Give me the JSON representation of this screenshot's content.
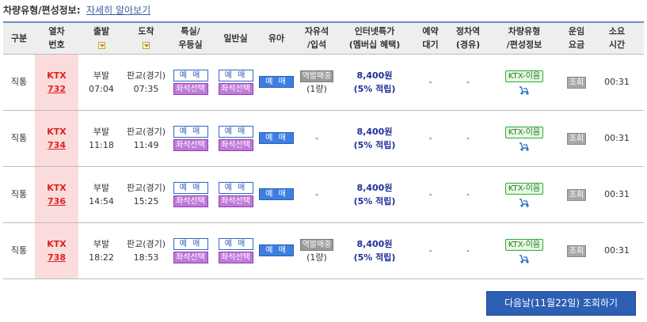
{
  "header": {
    "label": "차량유형/편성정보:",
    "link": "자세히 알아보기"
  },
  "columns": {
    "type": "구분",
    "train_no": [
      "열차",
      "번호"
    ],
    "depart": "출발",
    "arrive": "도착",
    "special": [
      "특실/",
      "우등실"
    ],
    "general": "일반실",
    "infant": "유아",
    "standing": [
      "자유석",
      "/입석"
    ],
    "internet": [
      "인터넷특가",
      "(멤버십 혜택)"
    ],
    "reserve_wait": [
      "예약",
      "대기"
    ],
    "stop_station": [
      "정차역",
      "(경유)"
    ],
    "car_type": [
      "차량유형",
      "/편성정보"
    ],
    "fare": [
      "운임",
      "요금"
    ],
    "duration": [
      "소요",
      "시간"
    ]
  },
  "labels": {
    "book": "예 매",
    "seat_select": "좌석선택",
    "lookup": "조회",
    "dash": "-"
  },
  "rows": [
    {
      "type": "직통",
      "train_name": "KTX",
      "train_no": "732",
      "dep_station": "부발",
      "dep_time": "07:04",
      "arr_station": "판교(경기)",
      "arr_time": "07:35",
      "standing_btn": "역발매중",
      "standing_count": "(1량)",
      "price": "8,400원",
      "point": "(5% 적립)",
      "reserve_wait": "-",
      "stop_station": "-",
      "car_badge": "KTX-이음",
      "duration": "00:31"
    },
    {
      "type": "직통",
      "train_name": "KTX",
      "train_no": "734",
      "dep_station": "부발",
      "dep_time": "11:18",
      "arr_station": "판교(경기)",
      "arr_time": "11:49",
      "standing_dash": "-",
      "price": "8,400원",
      "point": "(5% 적립)",
      "reserve_wait": "-",
      "stop_station": "-",
      "car_badge": "KTX-이음",
      "duration": "00:31"
    },
    {
      "type": "직통",
      "train_name": "KTX",
      "train_no": "736",
      "dep_station": "부발",
      "dep_time": "14:54",
      "arr_station": "판교(경기)",
      "arr_time": "15:25",
      "standing_dash": "-",
      "price": "8,400원",
      "point": "(5% 적립)",
      "reserve_wait": "-",
      "stop_station": "-",
      "car_badge": "KTX-이음",
      "duration": "00:31"
    },
    {
      "type": "직통",
      "train_name": "KTX",
      "train_no": "738",
      "dep_station": "부발",
      "dep_time": "18:22",
      "arr_station": "판교(경기)",
      "arr_time": "18:53",
      "standing_btn": "역발매중",
      "standing_count": "(1량)",
      "price": "8,400원",
      "point": "(5% 적립)",
      "reserve_wait": "-",
      "stop_station": "-",
      "car_badge": "KTX-이음",
      "duration": "00:31"
    }
  ],
  "next_day_button": "다음날(11월22일) 조회하기",
  "colors": {
    "train_cell_bg": "#fadcdc",
    "train_text": "#e02020",
    "price_text": "#1f2f9a",
    "next_button_bg": "#2d5fb3"
  }
}
